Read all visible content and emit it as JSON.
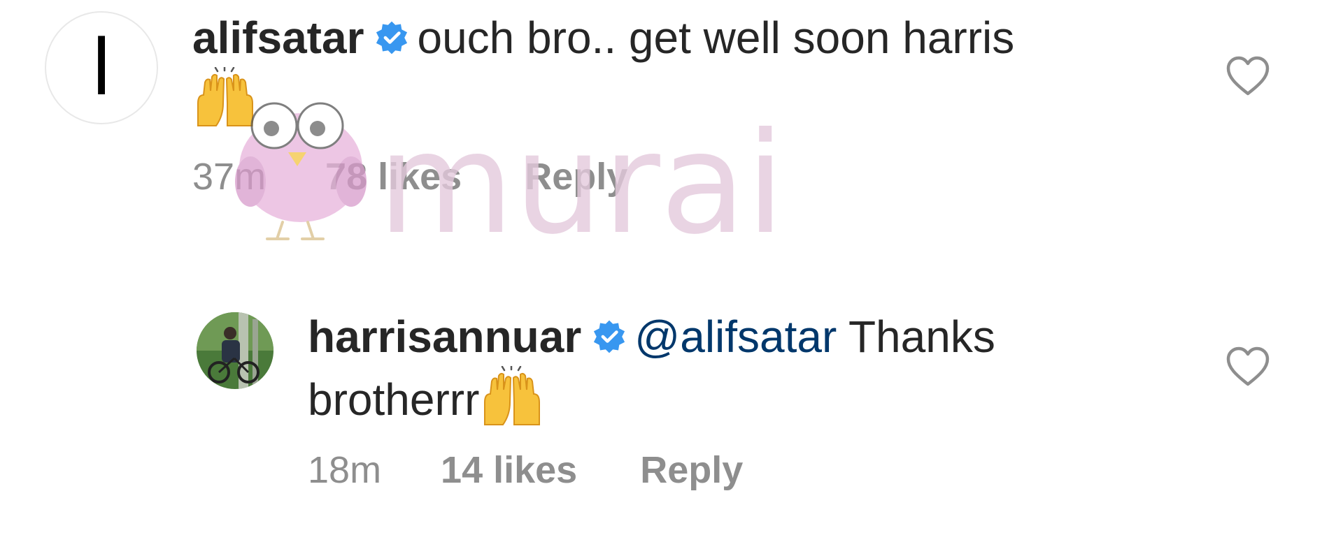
{
  "comments": [
    {
      "username": "alifsatar",
      "verified": true,
      "text": "ouch bro.. get well soon harris",
      "emoji": "raising-hands",
      "time": "37m",
      "likes": "78 likes",
      "reply_label": "Reply",
      "avatar_glyph": "ا"
    },
    {
      "username": "harrisannuar",
      "verified": true,
      "mention": "@alifsatar",
      "text": "Thanks brotherrr",
      "emoji": "raising-hands",
      "time": "18m",
      "likes": "14 likes",
      "reply_label": "Reply"
    }
  ],
  "watermark": {
    "text": "murai",
    "color": "#e3c9dc"
  },
  "colors": {
    "verified_badge": "#3897f0",
    "mention": "#00376b",
    "meta": "#8e8e8e"
  }
}
